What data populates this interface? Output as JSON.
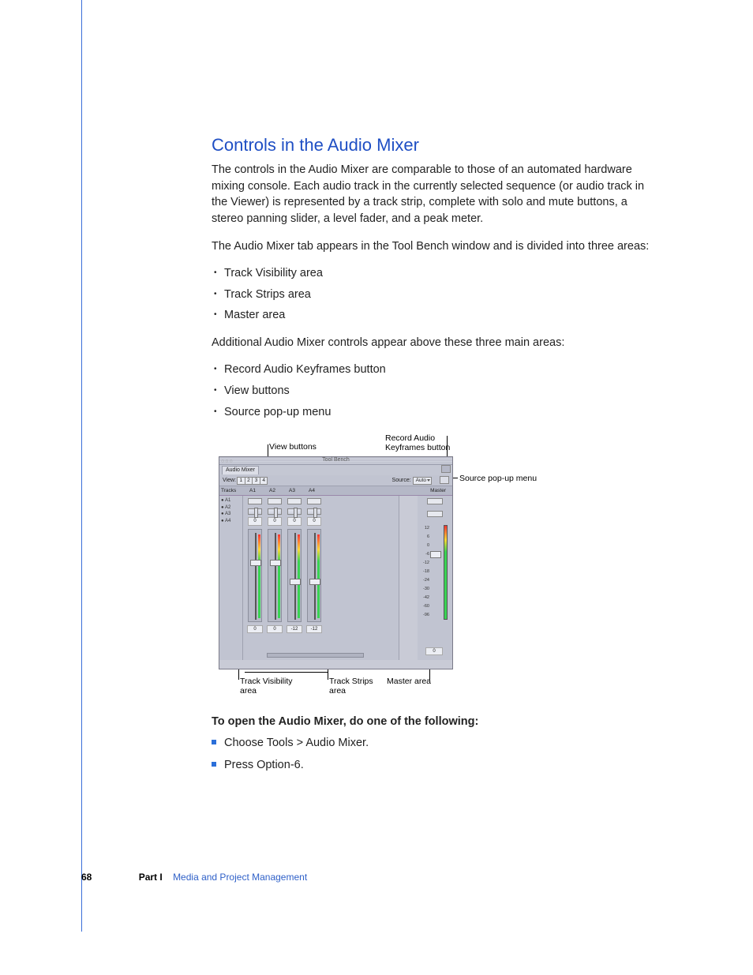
{
  "heading": "Controls in the Audio Mixer",
  "p1": "The controls in the Audio Mixer are comparable to those of an automated hardware mixing console. Each audio track in the currently selected sequence (or audio track in the Viewer) is represented by a track strip, complete with solo and mute buttons, a stereo panning slider, a level fader, and a peak meter.",
  "p2": "The Audio Mixer tab appears in the Tool Bench window and is divided into three areas:",
  "list1": {
    "a": "Track Visibility area",
    "b": "Track Strips area",
    "c": "Master area"
  },
  "p3": "Additional Audio Mixer controls appear above these three main areas:",
  "list2": {
    "a": "Record Audio Keyframes button",
    "b": "View buttons",
    "c": "Source pop-up menu"
  },
  "subhead": "To open the Audio Mixer, do one of the following:",
  "steps": {
    "a": "Choose Tools > Audio Mixer.",
    "b": "Press Option-6."
  },
  "callouts": {
    "viewButtons": "View buttons",
    "recordAudio1": "Record Audio",
    "recordAudio2": "Keyframes button",
    "sourcePopup": "Source pop-up menu",
    "trackVis1": "Track Visibility",
    "trackVis2": "area",
    "trackStrips1": "Track Strips",
    "trackStrips2": "area",
    "masterArea": "Master area"
  },
  "mixer": {
    "windowTitle": "Tool Bench",
    "tab": "Audio Mixer",
    "viewLabel": "View:",
    "viewBtns": {
      "b1": "1",
      "b2": "2",
      "b3": "3",
      "b4": "4"
    },
    "sourceLabel": "Source:",
    "sourceValue": "Auto",
    "hdrTracks": "Tracks",
    "hdrA1": "A1",
    "hdrA2": "A2",
    "hdrA3": "A3",
    "hdrA4": "A4",
    "hdrMaster": "Master",
    "vis": {
      "a": "● A1",
      "b": "● A2",
      "c": "● A3",
      "d": "● A4"
    },
    "pan0": "0",
    "level0": "0",
    "levelN12": "-12",
    "scale": {
      "s1": "12",
      "s2": "6",
      "s3": "0",
      "s4": "-6",
      "s5": "-12",
      "s6": "-18",
      "s7": "-24",
      "s8": "-30",
      "s9": "-42",
      "s10": "-60",
      "s11": "-96"
    },
    "masterVal": "0"
  },
  "footer": {
    "page": "68",
    "part": "Part I",
    "section": "Media and Project Management"
  }
}
